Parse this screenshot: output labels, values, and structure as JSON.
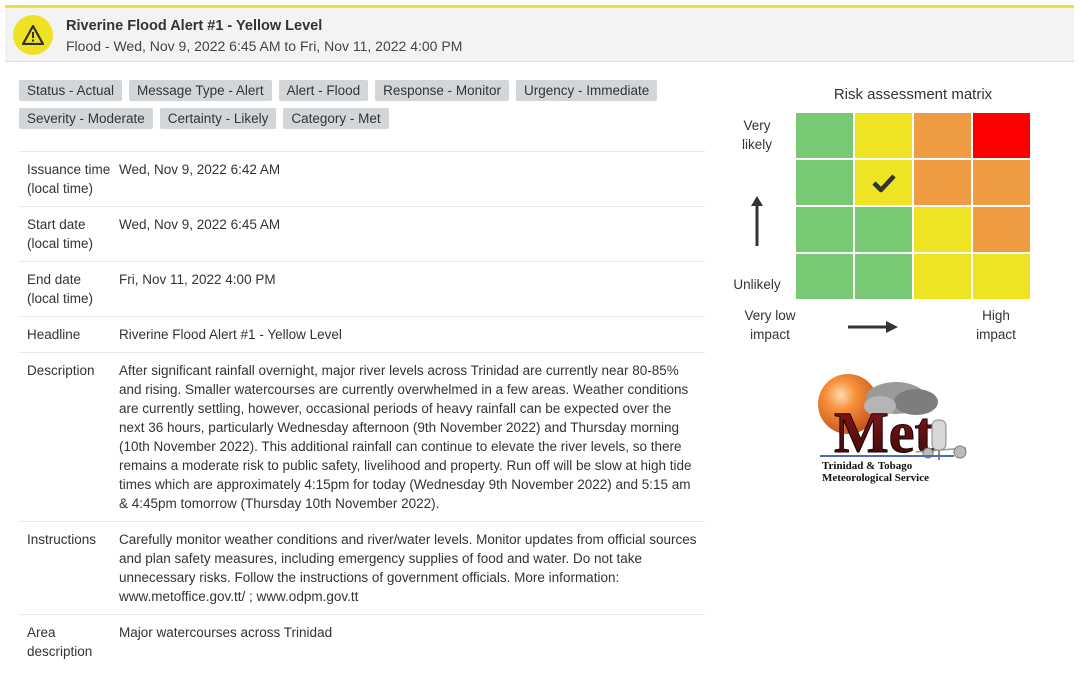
{
  "header": {
    "title": "Riverine Flood Alert #1 - Yellow Level",
    "subtitle": "Flood - Wed, Nov 9, 2022 6:45 AM to Fri, Nov 11, 2022 4:00 PM",
    "accent_color": "#ece13a",
    "icon": "warning-triangle-icon"
  },
  "tags": [
    [
      "Status - Actual",
      "Message Type - Alert",
      "Alert - Flood",
      "Response - Monitor",
      "Urgency - Immediate"
    ],
    [
      "Severity - Moderate",
      "Certainty - Likely",
      "Category - Met"
    ]
  ],
  "details": [
    {
      "label": "Issuance time (local time)",
      "value": "Wed, Nov 9, 2022 6:42 AM"
    },
    {
      "label": "Start date (local time)",
      "value": "Wed, Nov 9, 2022 6:45 AM"
    },
    {
      "label": "End date (local time)",
      "value": "Fri, Nov 11, 2022 4:00 PM"
    },
    {
      "label": "Headline",
      "value": "Riverine Flood Alert #1 - Yellow Level"
    },
    {
      "label": "Description",
      "value": "After significant rainfall overnight, major river levels across Trinidad are currently near 80-85% and rising. Smaller watercourses are currently overwhelmed in a few areas. Weather conditions are currently settling, however, occasional periods of heavy rainfall can be expected over the next 36 hours, particularly Wednesday afternoon (9th November 2022) and Thursday morning (10th November 2022). This additional rainfall can continue to elevate the river levels, so there remains a moderate risk to public safety, livelihood and property. Run off will be slow at high tide times which are approximately 4:15pm for today (Wednesday 9th November 2022) and 5:15 am & 4:45pm tomorrow (Thursday 10th November 2022)."
    },
    {
      "label": "Instructions",
      "value": "Carefully monitor weather conditions and river/water levels. Monitor updates from official sources and plan safety measures, including emergency supplies of food and water. Do not take unnecessary risks. Follow the instructions of government officials. More information: www.metoffice.gov.tt/ ; www.odpm.gov.tt"
    },
    {
      "label": "Area description",
      "value": "Major watercourses across Trinidad"
    }
  ],
  "matrix": {
    "title": "Risk assessment matrix",
    "y_top": "Very likely",
    "y_bottom": "Unlikely",
    "x_left": "Very low impact",
    "x_right": "High impact",
    "colors": {
      "green": "#79c974",
      "yellow": "#efe423",
      "orange": "#ee9b42",
      "red": "#fe0000"
    },
    "grid": [
      [
        "green",
        "yellow",
        "orange",
        "red"
      ],
      [
        "green",
        "yellow",
        "orange",
        "orange"
      ],
      [
        "green",
        "green",
        "yellow",
        "orange"
      ],
      [
        "green",
        "green",
        "yellow",
        "yellow"
      ]
    ],
    "selected": {
      "row": 1,
      "col": 1
    }
  },
  "logo": {
    "letters": "Met",
    "line1": "Trinidad & Tobago",
    "line2": "Meteorological Service"
  }
}
